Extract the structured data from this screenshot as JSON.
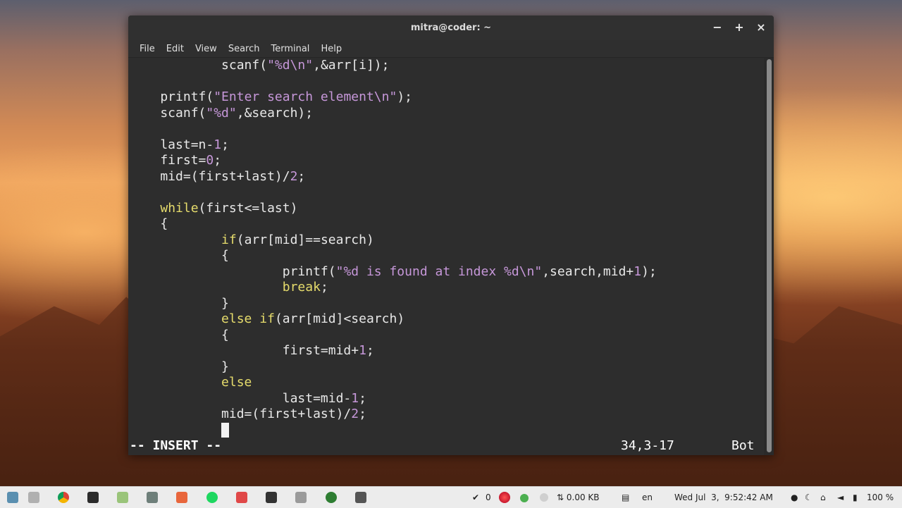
{
  "window": {
    "title": "mitra@coder: ~"
  },
  "menu": [
    "File",
    "Edit",
    "View",
    "Search",
    "Terminal",
    "Help"
  ],
  "code_lines": [
    [
      [
        "            scanf(",
        ""
      ],
      [
        "\"%d\\n\"",
        "str"
      ],
      [
        ",&arr[i]);",
        ""
      ]
    ],
    [
      [
        "",
        ""
      ]
    ],
    [
      [
        "    printf(",
        ""
      ],
      [
        "\"Enter search element\\n\"",
        "str"
      ],
      [
        ");",
        ""
      ]
    ],
    [
      [
        "    scanf(",
        ""
      ],
      [
        "\"%d\"",
        "str"
      ],
      [
        ",&search);",
        ""
      ]
    ],
    [
      [
        "",
        ""
      ]
    ],
    [
      [
        "    last=n-",
        ""
      ],
      [
        "1",
        "num"
      ],
      [
        ";",
        ""
      ]
    ],
    [
      [
        "    first=",
        ""
      ],
      [
        "0",
        "num"
      ],
      [
        ";",
        ""
      ]
    ],
    [
      [
        "    mid=(first+last)/",
        ""
      ],
      [
        "2",
        "num"
      ],
      [
        ";",
        ""
      ]
    ],
    [
      [
        "",
        ""
      ]
    ],
    [
      [
        "    ",
        ""
      ],
      [
        "while",
        "kw"
      ],
      [
        "(first<=last)",
        ""
      ]
    ],
    [
      [
        "    {",
        ""
      ]
    ],
    [
      [
        "            ",
        ""
      ],
      [
        "if",
        "kw"
      ],
      [
        "(arr[mid]==search)",
        ""
      ]
    ],
    [
      [
        "            {",
        ""
      ]
    ],
    [
      [
        "                    printf(",
        ""
      ],
      [
        "\"%d is found at index %d\\n\"",
        "str"
      ],
      [
        ",search,mid+",
        ""
      ],
      [
        "1",
        "num"
      ],
      [
        ");",
        ""
      ]
    ],
    [
      [
        "                    ",
        ""
      ],
      [
        "break",
        "kw"
      ],
      [
        ";",
        ""
      ]
    ],
    [
      [
        "            }",
        ""
      ]
    ],
    [
      [
        "            ",
        ""
      ],
      [
        "else",
        "kw"
      ],
      [
        " ",
        ""
      ],
      [
        "if",
        "kw"
      ],
      [
        "(arr[mid]<search)",
        ""
      ]
    ],
    [
      [
        "            {",
        ""
      ]
    ],
    [
      [
        "                    first=mid+",
        ""
      ],
      [
        "1",
        "num"
      ],
      [
        ";",
        ""
      ]
    ],
    [
      [
        "            }",
        ""
      ]
    ],
    [
      [
        "            ",
        ""
      ],
      [
        "else",
        "kw"
      ]
    ],
    [
      [
        "                    last=mid-",
        ""
      ],
      [
        "1",
        "num"
      ],
      [
        ";",
        ""
      ]
    ],
    [
      [
        "            mid=(first+last)/",
        ""
      ],
      [
        "2",
        "num"
      ],
      [
        ";",
        ""
      ]
    ],
    [
      [
        "            ",
        ""
      ]
    ]
  ],
  "status": {
    "mode": "-- INSERT --",
    "position": "34,3-17",
    "scroll": "Bot"
  },
  "taskbar": {
    "apps": [
      "show-desktop-icon",
      "files-icon",
      "chrome-icon",
      "terminal-icon",
      "android-studio-icon",
      "calculator-icon",
      "software-center-icon",
      "spotify-icon",
      "screenshot-icon",
      "code-terminal-icon",
      "screenshot-tool-icon",
      "globe-icon",
      "clapper-icon"
    ],
    "notifications": "0",
    "network_speed": "⇅ 0.00 KB",
    "keyboard_layout": "en",
    "clock": "Wed Jul  3,  9:52:42 AM",
    "battery": "100 %"
  },
  "colors": {
    "keyword": "#e6dc6c",
    "string": "#c697d9",
    "background": "#2d2d2d"
  }
}
